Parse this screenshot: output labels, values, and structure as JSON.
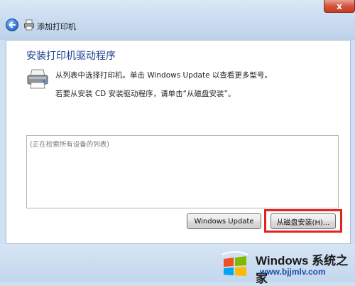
{
  "window": {
    "title": "添加打印机",
    "close_label": "x"
  },
  "main": {
    "heading": "安装打印机驱动程序",
    "instruction_1": "从列表中选择打印机。单击 Windows Update 以查看更多型号。",
    "instruction_2": "若要从安装 CD 安装驱动程序，请单击“从磁盘安装”。",
    "list_placeholder": "(正在检索所有设备的列表)"
  },
  "buttons": {
    "windows_update": "Windows Update",
    "have_disk": "从磁盘安装(H)..."
  },
  "watermark": {
    "title": "Windows 系统之家",
    "url": "www.bjjmlv.com"
  },
  "colors": {
    "highlight": "#e0251d",
    "heading": "#1f3f8f"
  },
  "icons": {
    "back": "back-arrow-icon",
    "printer": "printer-icon",
    "logo": "windows-logo-icon"
  }
}
